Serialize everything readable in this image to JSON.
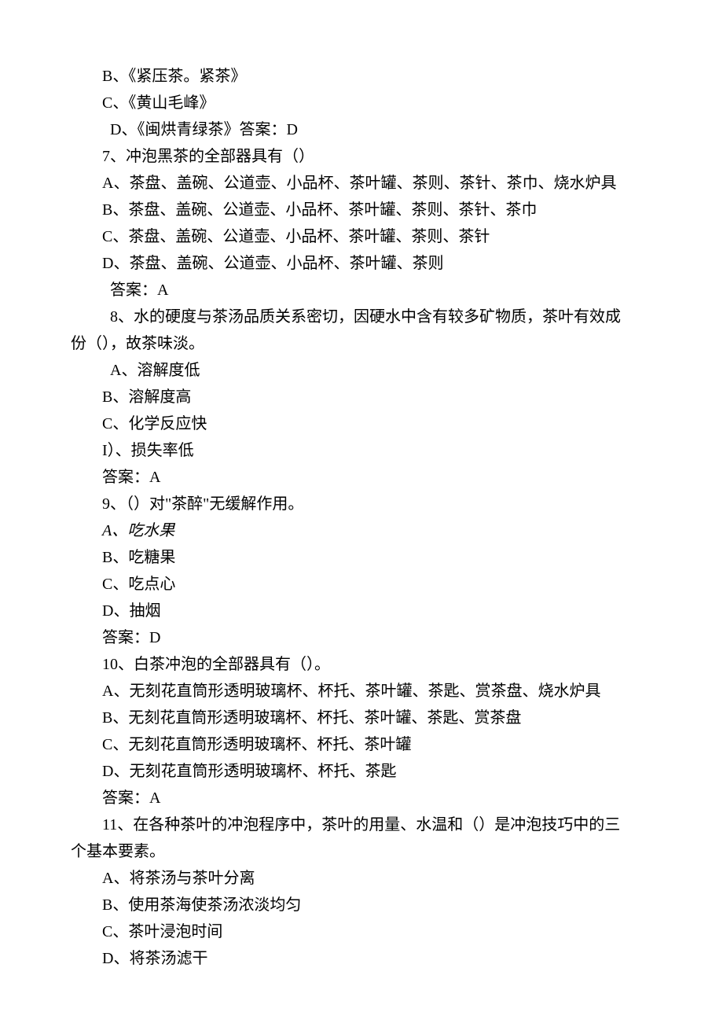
{
  "lines": [
    {
      "cls": "indent1",
      "text": "B、《紧压茶。紧茶》"
    },
    {
      "cls": "indent1",
      "text": "C、《黄山毛峰》"
    },
    {
      "cls": "indent2",
      "text": "D、《闽烘青绿茶》答案：D"
    },
    {
      "cls": "indent1",
      "text": "7、冲泡黑茶的全部器具有（）"
    },
    {
      "cls": "indent1",
      "text": "A、茶盘、盖碗、公道壶、小品杯、茶叶罐、茶则、茶针、茶巾、烧水炉具"
    },
    {
      "cls": "indent1",
      "text": "B、茶盘、盖碗、公道壶、小品杯、茶叶罐、茶则、茶针、茶巾"
    },
    {
      "cls": "indent1",
      "text": "C、茶盘、盖碗、公道壶、小品杯、茶叶罐、茶则、茶针"
    },
    {
      "cls": "indent1",
      "text": "D、茶盘、盖碗、公道壶、小品杯、茶叶罐、茶则"
    },
    {
      "cls": "indent2",
      "text": "答案：A"
    },
    {
      "cls": "indent2",
      "text": "8、水的硬度与茶汤品质关系密切，因硬水中含有较多矿物质，茶叶有效成"
    },
    {
      "cls": "no-indent",
      "text": "份（），故茶味淡。"
    },
    {
      "cls": "indent2",
      "text": "A、溶解度低"
    },
    {
      "cls": "indent1",
      "text": "B、溶解度高"
    },
    {
      "cls": "indent1",
      "text": "C、化学反应快"
    },
    {
      "cls": "indent1",
      "text": "I）、损失率低"
    },
    {
      "cls": "indent1",
      "text": "答案：A"
    },
    {
      "cls": "indent1",
      "text": "9、（）对\"茶醉\"无缓解作用。"
    },
    {
      "cls": "indent1 italic",
      "text": "A、吃水果"
    },
    {
      "cls": "indent1",
      "text": "B、吃糖果"
    },
    {
      "cls": "indent1",
      "text": "C、吃点心"
    },
    {
      "cls": "indent1",
      "text": "D、抽烟"
    },
    {
      "cls": "indent1",
      "text": "答案：D"
    },
    {
      "cls": "indent1",
      "text": "10、白茶冲泡的全部器具有（）。"
    },
    {
      "cls": "indent1",
      "text": "A、无刻花直筒形透明玻璃杯、杯托、茶叶罐、茶匙、赏茶盘、烧水炉具"
    },
    {
      "cls": "indent1",
      "text": "B、无刻花直筒形透明玻璃杯、杯托、茶叶罐、茶匙、赏茶盘"
    },
    {
      "cls": "indent1",
      "text": "C、无刻花直筒形透明玻璃杯、杯托、茶叶罐"
    },
    {
      "cls": "indent1",
      "text": "D、无刻花直筒形透明玻璃杯、杯托、茶匙"
    },
    {
      "cls": "indent1",
      "text": "答案：A"
    },
    {
      "cls": "indent1",
      "text": "11、在各种茶叶的冲泡程序中，茶叶的用量、水温和（）是冲泡技巧中的三"
    },
    {
      "cls": "no-indent",
      "text": "个基本要素。"
    },
    {
      "cls": "indent1",
      "text": "A、将茶汤与茶叶分离"
    },
    {
      "cls": "indent1",
      "text": "B、使用茶海使茶汤浓淡均匀"
    },
    {
      "cls": "indent1",
      "text": "C、茶叶浸泡时间"
    },
    {
      "cls": "indent1",
      "text": "D、将茶汤滤干"
    }
  ]
}
